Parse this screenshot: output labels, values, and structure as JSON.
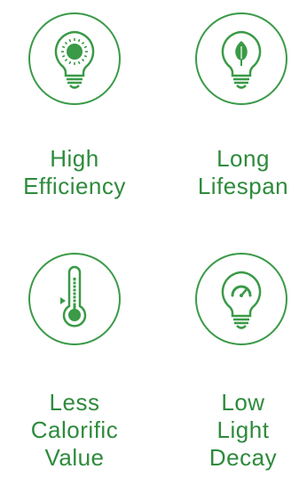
{
  "features": [
    {
      "icon": "sun-bulb-icon",
      "lines": [
        "High",
        "Efficiency"
      ]
    },
    {
      "icon": "leaf-bulb-icon",
      "lines": [
        "Long",
        "Lifespan"
      ]
    },
    {
      "icon": "thermometer-icon",
      "lines": [
        "Less",
        "Calorific",
        "Value"
      ]
    },
    {
      "icon": "gauge-bulb-icon",
      "lines": [
        "Low",
        "Light",
        "Decay"
      ]
    }
  ],
  "colors": {
    "accent": "#2e8b3c",
    "icon_fill": "#3a9a47"
  }
}
